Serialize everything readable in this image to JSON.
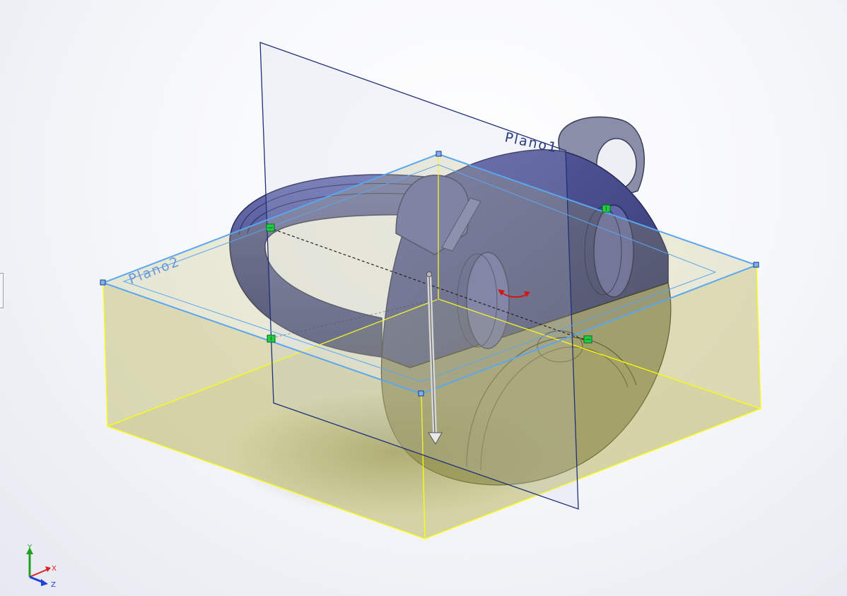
{
  "viewport": {
    "plane_front_label": "Plano1",
    "plane_top_label": "Plano2"
  },
  "triad": {
    "x_label": "X",
    "y_label": "Y",
    "z_label": "Z"
  },
  "colors": {
    "part_blue": "#4a5090",
    "part_dark": "#2f3368",
    "bounding_box_fill": "#b8b256",
    "bounding_box_edge": "#ffff00",
    "plane_edge_front": "#1f2f7a",
    "plane_edge_top": "#5aa6f0",
    "handle_green": "#22cc44",
    "axis_x": "#e02020",
    "axis_y": "#20a020",
    "axis_z": "#2040e0"
  },
  "icons": [
    "drag-arrow-icon",
    "rotate-handle-icon",
    "triad-icon"
  ]
}
